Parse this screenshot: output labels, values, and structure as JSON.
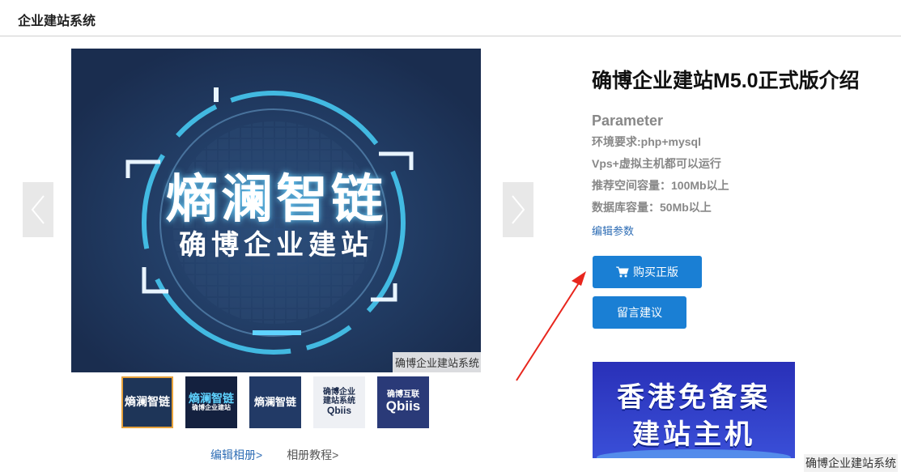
{
  "header": {
    "site_title": "企业建站系统"
  },
  "gallery": {
    "main_line1": "熵澜智链",
    "main_line2": "确博企业建站",
    "watermark": "确博企业建站系统",
    "thumbnails": [
      {
        "line1": "熵澜智链",
        "line2": ""
      },
      {
        "line1": "熵澜智链",
        "line2": "确博企业建站"
      },
      {
        "line1": "熵澜智链",
        "line2": ""
      },
      {
        "line1": "确博企业",
        "line2": "建站系统",
        "line3": "Qbiis"
      },
      {
        "line1": "确博互联",
        "line2": "Qbiis"
      }
    ],
    "edit_album": "编辑相册>",
    "album_tutorial": "相册教程>"
  },
  "product": {
    "title": "确博企业建站M5.0正式版介绍",
    "param_heading": "Parameter",
    "params": [
      "环境要求:php+mysql",
      "Vps+虚拟主机都可以运行",
      "推荐空间容量：100Mb以上",
      "数据库容量：50Mb以上"
    ],
    "edit_params": "编辑参数",
    "buy_label": "购买正版",
    "suggest_label": "留言建议"
  },
  "banner": {
    "line1": "香港免备案",
    "line2": "建站主机"
  },
  "footer_watermark": "确博企业建站系统",
  "colors": {
    "button_blue": "#1a7fd4",
    "link_blue": "#2e6db5",
    "image_bg": "#1d3357",
    "annotation_red": "#e8261d"
  }
}
